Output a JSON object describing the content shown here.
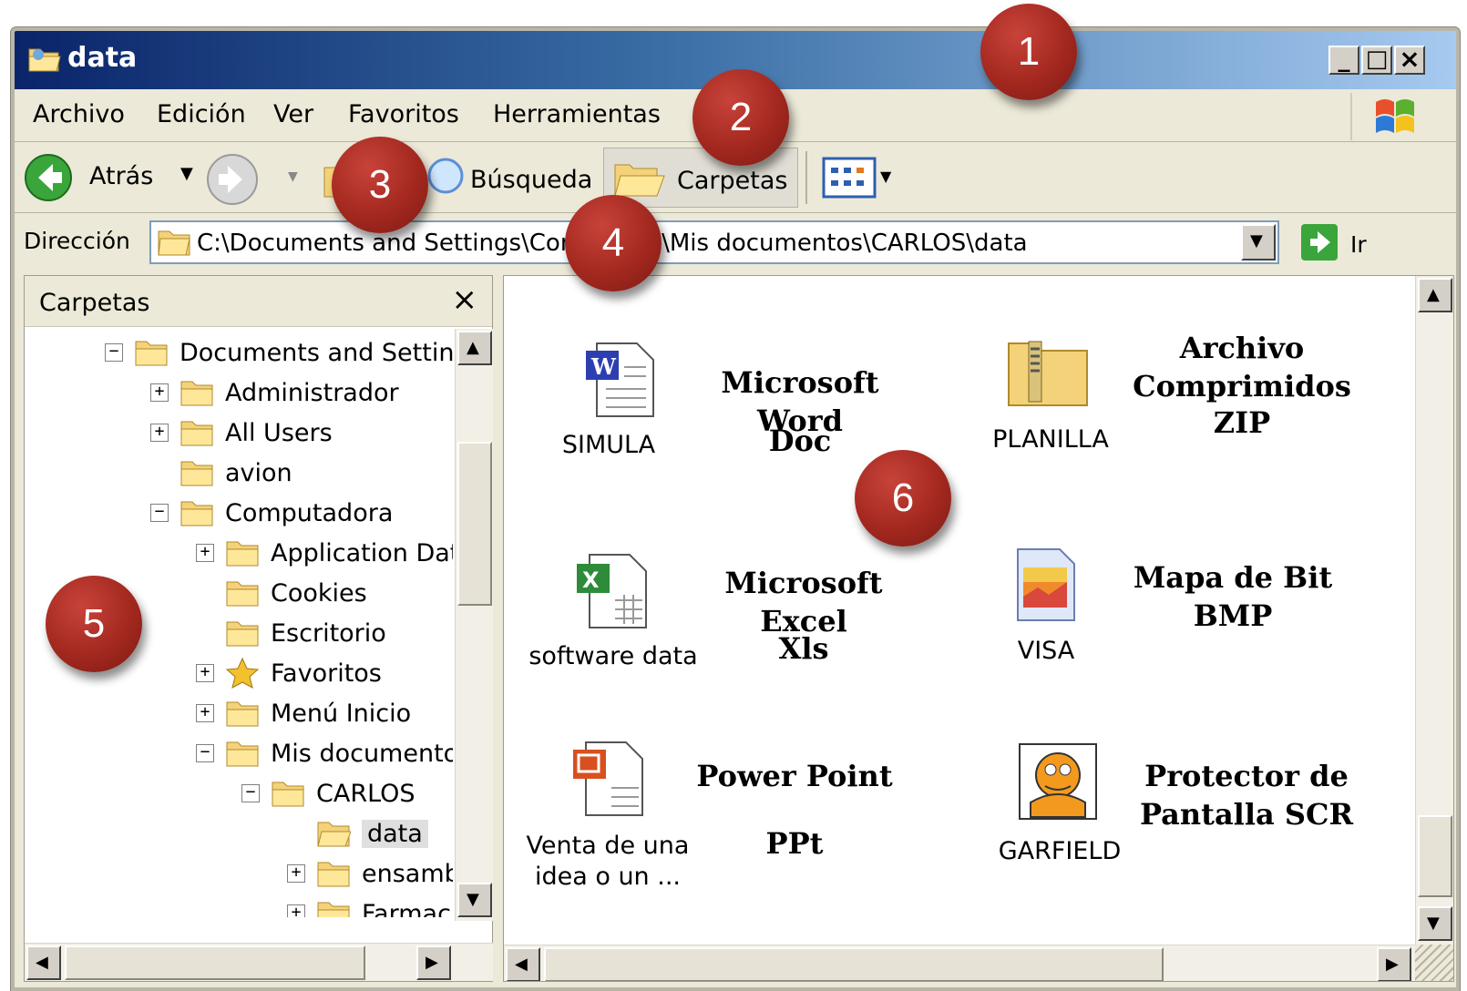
{
  "window": {
    "title": "data"
  },
  "menu": [
    "Archivo",
    "Edición",
    "Ver",
    "Favoritos",
    "Herramientas"
  ],
  "toolbar": {
    "back": "Atrás",
    "search": "Búsqueda",
    "folders": "Carpetas"
  },
  "address": {
    "label": "Dirección",
    "path": "C:\\Documents and Settings\\Com",
    "path2": "a\\Mis documentos\\CARLOS\\data",
    "go": "Ir"
  },
  "left_panel": {
    "title": "Carpetas"
  },
  "tree": [
    "Documents and Settings",
    "Administrador",
    "All Users",
    "avion",
    "Computadora",
    "Application Data",
    "Cookies",
    "Escritorio",
    "Favoritos",
    "Menú Inicio",
    "Mis documentos",
    "CARLOS",
    "data",
    "ensamb",
    "Farmaci"
  ],
  "files": [
    {
      "name": "SIMULA",
      "type1": "Microsoft Word",
      "type2": "Doc",
      "icon": "word-doc-icon"
    },
    {
      "name": "PLANILLA",
      "type1": "Archivo",
      "type2": "Comprimidos",
      "type3": "ZIP",
      "icon": "zip-folder-icon"
    },
    {
      "name": "software data",
      "type1": "Microsoft Excel",
      "type2": "Xls",
      "icon": "excel-icon"
    },
    {
      "name": "VISA",
      "type1": "Mapa de Bit",
      "type2": "BMP",
      "icon": "bitmap-icon"
    },
    {
      "name": "Venta de una",
      "name2": "idea o un ...",
      "type1": "Power Point",
      "type2": "PPt",
      "icon": "powerpoint-icon"
    },
    {
      "name": "GARFIELD",
      "type1": "Protector de",
      "type2": "Pantalla SCR",
      "icon": "screensaver-icon"
    }
  ],
  "callouts": [
    "1",
    "2",
    "3",
    "4",
    "5",
    "6"
  ]
}
